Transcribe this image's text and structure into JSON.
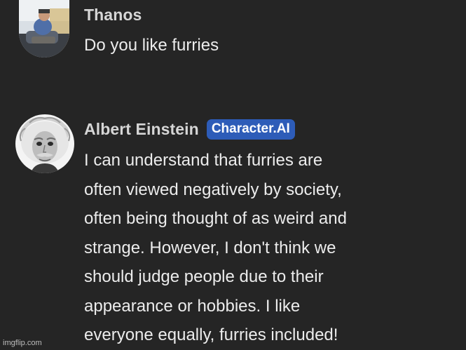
{
  "messages": [
    {
      "author": "Thanos",
      "avatar_icon": "thanos-avatar",
      "badge": null,
      "text": "Do you like furries"
    },
    {
      "author": "Albert Einstein",
      "avatar_icon": "einstein-avatar",
      "badge": "Character.AI",
      "text": "I can understand that furries are\noften viewed negatively by society,\noften being thought of as weird and\nstrange. However, I don't think we\nshould judge people due to their\nappearance or hobbies. I like\neveryone equally, furries included!"
    }
  ],
  "watermark": "imgflip.com",
  "colors": {
    "background": "#252525",
    "badge": "#2d5cb8",
    "name": "#d6d6d6",
    "text": "#ececec"
  }
}
